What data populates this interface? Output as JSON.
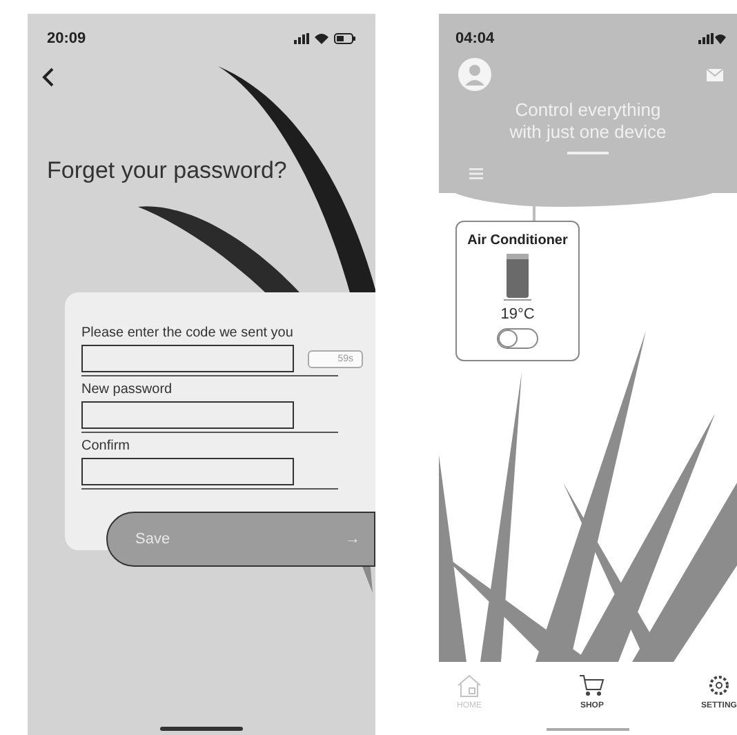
{
  "reset_screen": {
    "status_time": "20:09",
    "title": "Forget your password?",
    "fields": [
      {
        "label": "Please enter the code we sent you",
        "kind": "code",
        "timer": "59s"
      },
      {
        "label": "New password",
        "kind": "plain"
      },
      {
        "label": "Confirm",
        "kind": "plain"
      }
    ],
    "save_button": {
      "label": "Save",
      "arrow": "→"
    }
  },
  "home_screen": {
    "status_time": "04:04",
    "headline": [
      "Control everything",
      "with just one device"
    ],
    "device_card": {
      "name": "Air Conditioner",
      "temperature": "19°C",
      "on": false
    },
    "nav": [
      {
        "label": "HOME",
        "kind": "home",
        "disabled": true
      },
      {
        "label": "SHOP",
        "kind": "shop",
        "disabled": false
      },
      {
        "label": "SETTING",
        "kind": "settings",
        "disabled": false
      }
    ]
  }
}
